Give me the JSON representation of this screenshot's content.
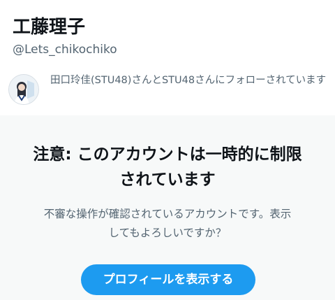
{
  "profile": {
    "display_name": "工藤理子",
    "handle": "@Lets_chikochiko"
  },
  "followed_by": {
    "avatar_icon": "user-avatar-photo",
    "text": "田口玲佳(STU48)さんとSTU48さんにフォローされています"
  },
  "warning": {
    "title": "注意: このアカウントは一時的に制限されています",
    "body": "不審な操作が確認されているアカウントです。表示してもよろしいですか？",
    "button_label": "プロフィールを表示する"
  },
  "colors": {
    "accent": "#1d9bf0",
    "text_primary": "#0f1419",
    "text_secondary": "#536471",
    "panel_background": "#f7f9f9"
  }
}
